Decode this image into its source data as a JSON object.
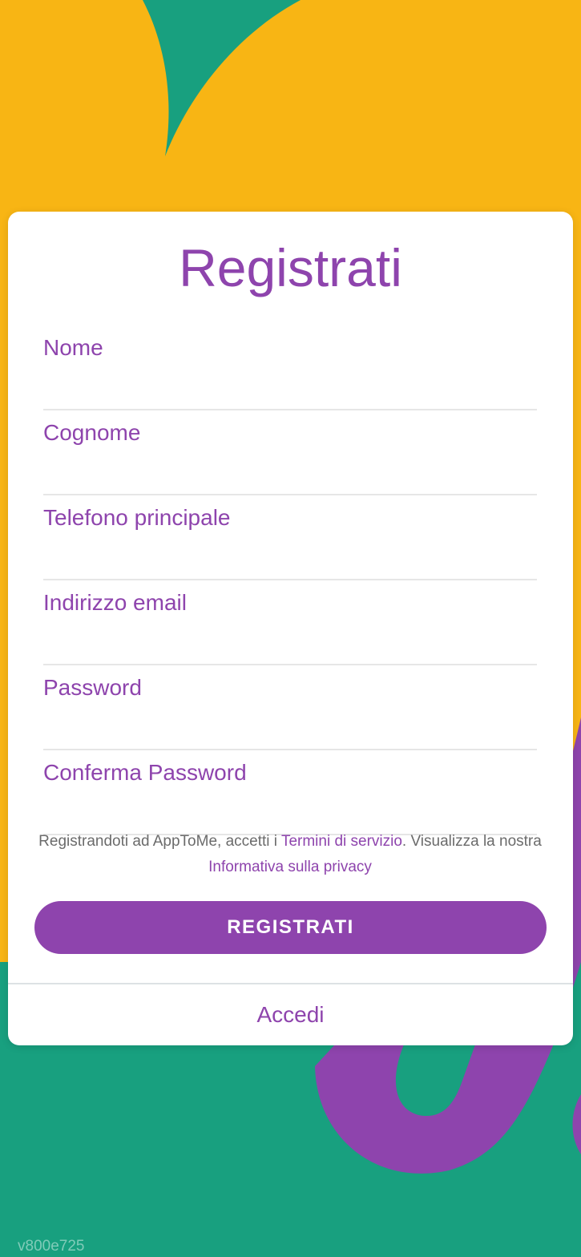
{
  "title": "Registrati",
  "fields": {
    "nome": {
      "placeholder": "Nome",
      "value": ""
    },
    "cognome": {
      "placeholder": "Cognome",
      "value": ""
    },
    "telefono": {
      "placeholder": "Telefono principale",
      "value": ""
    },
    "email": {
      "placeholder": "Indirizzo email",
      "value": ""
    },
    "password": {
      "placeholder": "Password",
      "value": ""
    },
    "conferma": {
      "placeholder": "Conferma Password",
      "value": ""
    }
  },
  "terms": {
    "text_before": "Registrandoti ad AppToMe, accetti i ",
    "terms_link": "Termini di servizio",
    "text_middle": ". Visualizza la nostra ",
    "privacy_link": "Informativa sulla privacy"
  },
  "register_button": "REGISTRATI",
  "login_link": "Accedi",
  "version": "v800e725",
  "colors": {
    "accent": "#8e44ad",
    "yellow": "#f8b514",
    "green": "#18a07f",
    "white": "#ffffff"
  }
}
